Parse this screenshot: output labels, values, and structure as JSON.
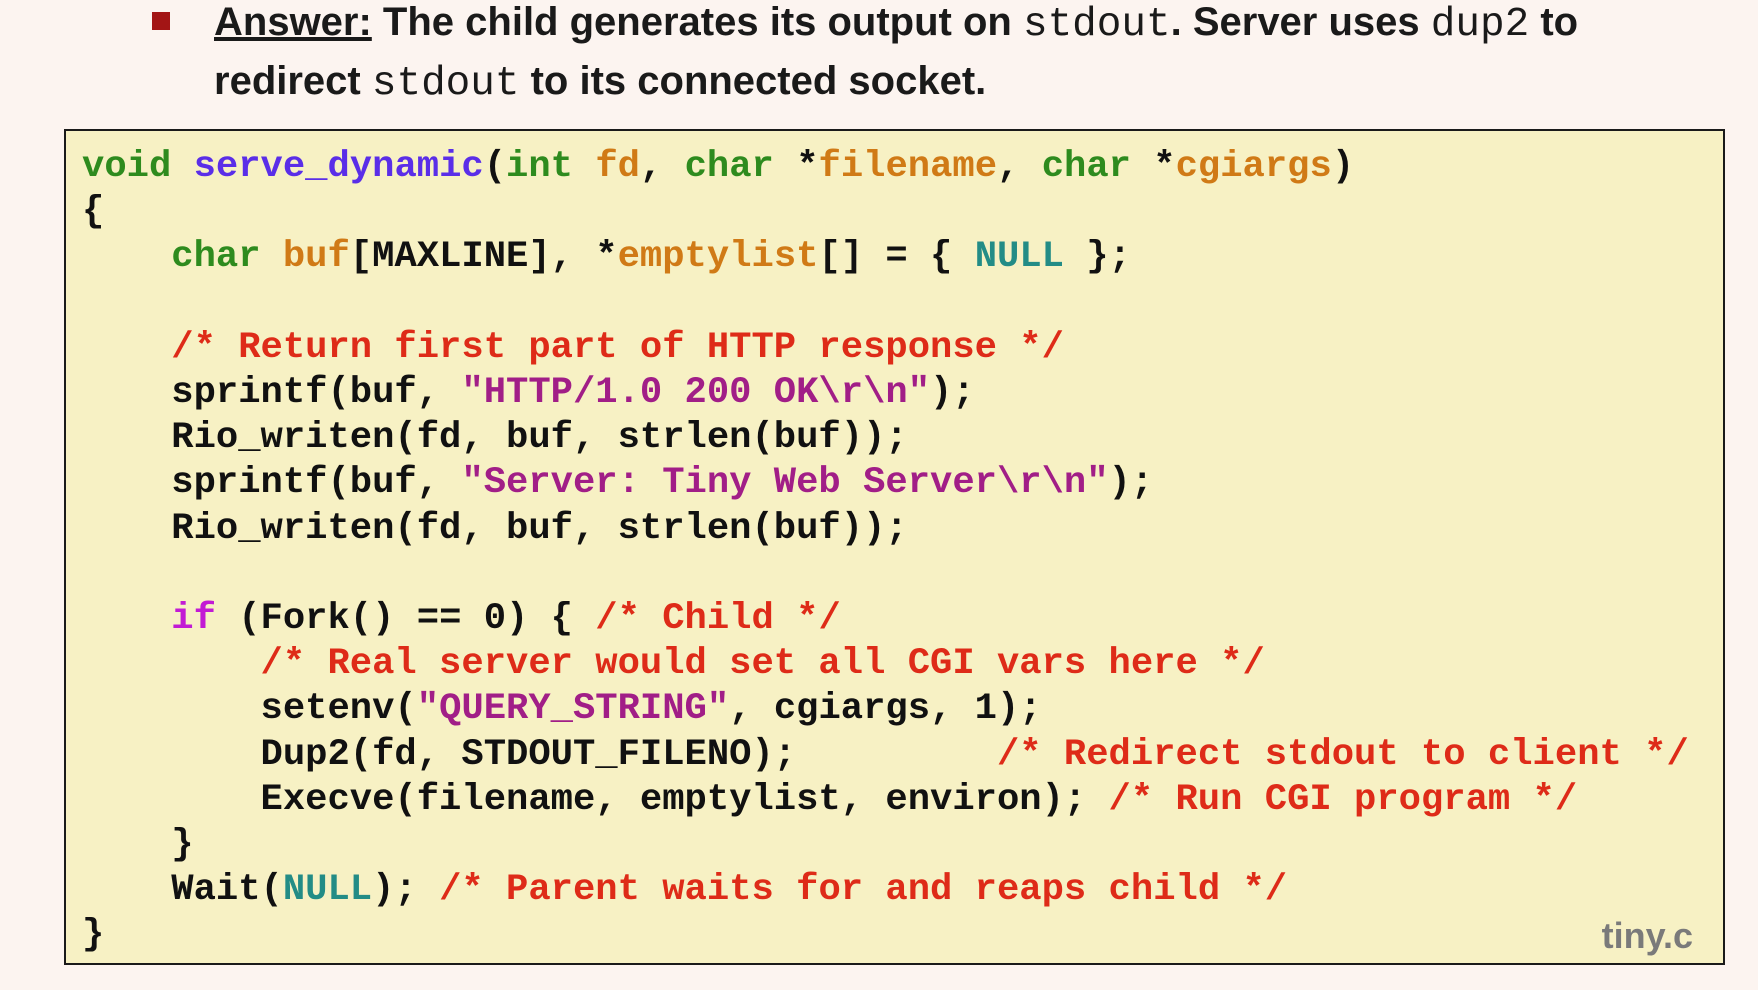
{
  "bullet": {
    "answer_label": "Answer:",
    "text_1": " The child generates its output on ",
    "code_stdout_1": "stdout",
    "text_2": ".  Server uses ",
    "code_dup2": "dup2",
    "text_3": "  to redirect ",
    "code_stdout_2": "stdout",
    "text_4": "  to its connected socket."
  },
  "code": {
    "filename": "tiny.c",
    "l1": {
      "t1": "void",
      "t2": " ",
      "t3": "serve_dynamic",
      "t4": "(",
      "t5": "int",
      "t6": " ",
      "t7": "fd",
      "t8": ", ",
      "t9": "char",
      "t10": " *",
      "t11": "filename",
      "t12": ", ",
      "t13": "char",
      "t14": " *",
      "t15": "cgiargs",
      "t16": ")"
    },
    "l2": "{",
    "l3": {
      "t1": "    ",
      "t2": "char",
      "t3": " ",
      "t4": "buf",
      "t5": "[MAXLINE], *",
      "t6": "emptylist",
      "t7": "[] = { ",
      "t8": "NULL",
      "t9": " };"
    },
    "l4": "",
    "l5": {
      "t1": "    ",
      "t2": "/* Return first part of HTTP response */"
    },
    "l6": {
      "t1": "    sprintf(buf, ",
      "t2": "\"HTTP/1.0 200 OK\\r\\n\"",
      "t3": ");"
    },
    "l7": "    Rio_writen(fd, buf, strlen(buf));",
    "l8": {
      "t1": "    sprintf(buf, ",
      "t2": "\"Server: Tiny Web Server\\r\\n\"",
      "t3": ");"
    },
    "l9": "    Rio_writen(fd, buf, strlen(buf));",
    "l10": "",
    "l11": {
      "t1": "    ",
      "t2": "if",
      "t3": " (Fork() == 0) { ",
      "t4": "/* Child */"
    },
    "l12": {
      "t1": "        ",
      "t2": "/* Real server would set all CGI vars here */"
    },
    "l13": {
      "t1": "        setenv(",
      "t2": "\"QUERY_STRING\"",
      "t3": ", cgiargs, 1);"
    },
    "l14": {
      "t1": "        Dup2(fd, STDOUT_FILENO);         ",
      "t2": "/* Redirect stdout to client */"
    },
    "l15": {
      "t1": "        Execve(filename, emptylist, environ); ",
      "t2": "/* Run CGI program */"
    },
    "l16": "    }",
    "l17": {
      "t1": "    Wait(",
      "t2": "NULL",
      "t3": "); ",
      "t4": "/* Parent waits for and reaps child */"
    },
    "l18": "}"
  }
}
